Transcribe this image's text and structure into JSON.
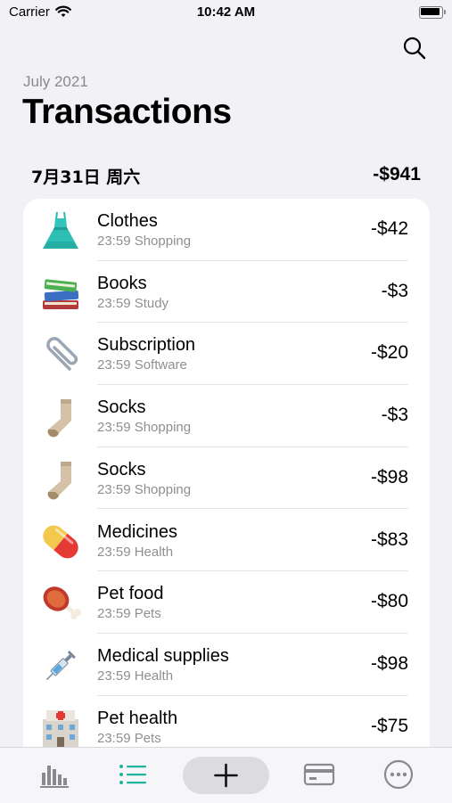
{
  "status_bar": {
    "carrier": "Carrier",
    "time": "10:42 AM"
  },
  "header": {
    "month": "July 2021",
    "title": "Transactions"
  },
  "day": {
    "date": "7月31日 周六",
    "total": "-$941"
  },
  "transactions": [
    {
      "name": "Clothes",
      "time": "23:59",
      "category": "Shopping",
      "sub": "23:59 Shopping",
      "amount": "-$42",
      "icon": "dress-icon"
    },
    {
      "name": "Books",
      "time": "23:59",
      "category": "Study",
      "sub": "23:59 Study",
      "amount": "-$3",
      "icon": "books-icon"
    },
    {
      "name": "Subscription",
      "time": "23:59",
      "category": "Software",
      "sub": "23:59 Software",
      "amount": "-$20",
      "icon": "paperclip-icon"
    },
    {
      "name": "Socks",
      "time": "23:59",
      "category": "Shopping",
      "sub": "23:59 Shopping",
      "amount": "-$3",
      "icon": "socks-icon"
    },
    {
      "name": "Socks",
      "time": "23:59",
      "category": "Shopping",
      "sub": "23:59 Shopping",
      "amount": "-$98",
      "icon": "socks-icon"
    },
    {
      "name": "Medicines",
      "time": "23:59",
      "category": "Health",
      "sub": "23:59 Health",
      "amount": "-$83",
      "icon": "pill-icon"
    },
    {
      "name": "Pet food",
      "time": "23:59",
      "category": "Pets",
      "sub": "23:59 Pets",
      "amount": "-$80",
      "icon": "meat-on-bone-icon"
    },
    {
      "name": "Medical supplies",
      "time": "23:59",
      "category": "Health",
      "sub": "23:59 Health",
      "amount": "-$98",
      "icon": "syringe-icon"
    },
    {
      "name": "Pet health",
      "time": "23:59",
      "category": "Pets",
      "sub": "23:59 Pets",
      "amount": "-$75",
      "icon": "hospital-icon"
    }
  ],
  "tab_bar": {
    "items": [
      {
        "icon": "bar-chart-icon",
        "selected": false
      },
      {
        "icon": "list-icon",
        "selected": true
      },
      {
        "icon": "plus-icon",
        "selected": false
      },
      {
        "icon": "credit-card-icon",
        "selected": false
      },
      {
        "icon": "more-icon",
        "selected": false
      }
    ]
  },
  "colors": {
    "accent": "#1fb39c",
    "background": "#f2f2f6",
    "secondary_text": "#8a8a8e"
  }
}
